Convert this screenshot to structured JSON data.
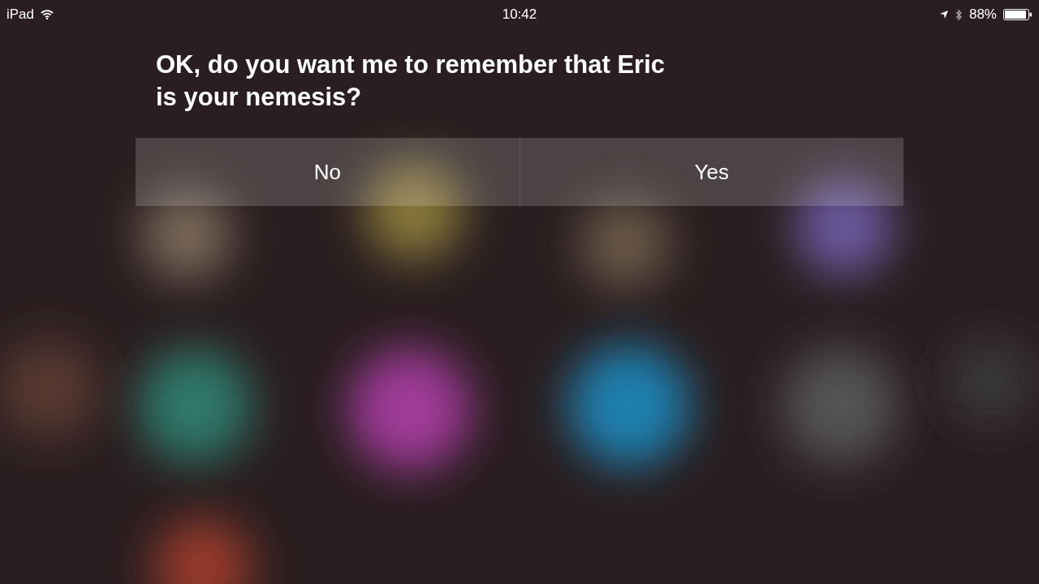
{
  "status_bar": {
    "device": "iPad",
    "time": "10:42",
    "battery": "88%"
  },
  "siri": {
    "question": "OK, do you want me to remember that Eric is your nemesis?",
    "buttons": [
      "No",
      "Yes"
    ]
  }
}
